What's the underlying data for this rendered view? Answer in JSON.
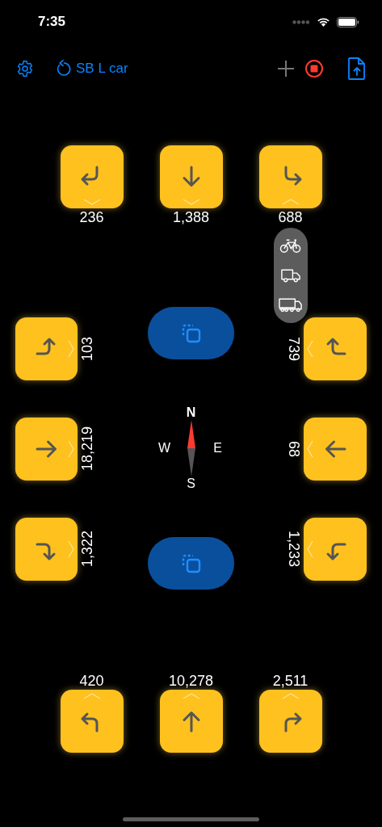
{
  "status_bar": {
    "time": "7:35"
  },
  "toolbar": {
    "title": "SB L car",
    "recording": true
  },
  "approaches": [
    {
      "kind": "north",
      "movements": [
        {
          "kind": "right",
          "count": "236",
          "expanded": false
        },
        {
          "kind": "straight",
          "count": "1,388",
          "expanded": false
        },
        {
          "kind": "left",
          "count": "688",
          "expanded": true,
          "vehicle_options": [
            {
              "kind": "bicycle"
            },
            {
              "kind": "van"
            },
            {
              "kind": "truck"
            }
          ]
        }
      ]
    },
    {
      "kind": "west",
      "movements": [
        {
          "kind": "left",
          "count": "103",
          "expanded": false
        },
        {
          "kind": "straight",
          "count": "18,219",
          "expanded": false
        },
        {
          "kind": "right",
          "count": "1,322",
          "expanded": false
        }
      ]
    },
    {
      "kind": "east",
      "movements": [
        {
          "kind": "right",
          "count": "739",
          "expanded": false
        },
        {
          "kind": "straight",
          "count": "68",
          "expanded": false
        },
        {
          "kind": "left",
          "count": "1,233",
          "expanded": false
        }
      ]
    },
    {
      "kind": "south",
      "movements": [
        {
          "kind": "left",
          "count": "420",
          "expanded": false
        },
        {
          "kind": "straight",
          "count": "10,278",
          "expanded": false
        },
        {
          "kind": "right",
          "count": "2,511",
          "expanded": false
        }
      ]
    }
  ],
  "compass": {
    "north": "N",
    "west": "W",
    "east": "E",
    "south": "S"
  }
}
